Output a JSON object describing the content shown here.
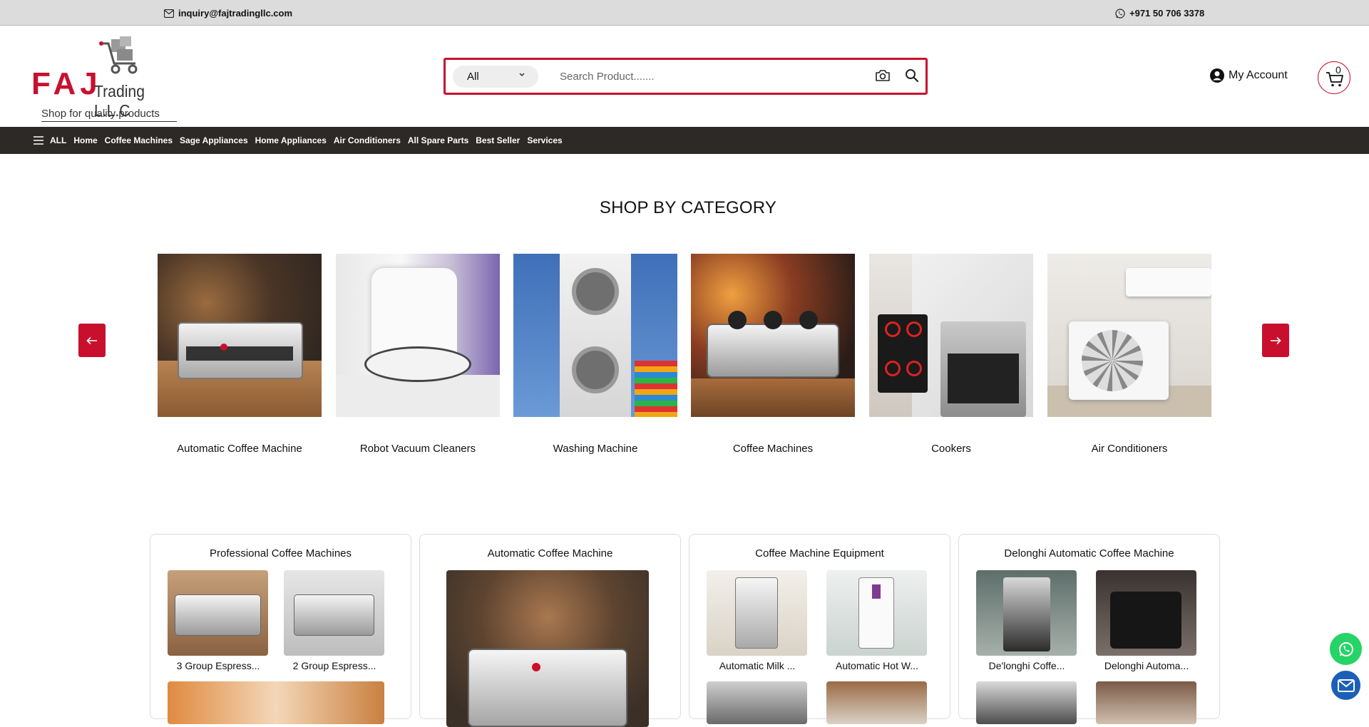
{
  "topbar": {
    "email": "inquiry@fajtradingllc.com",
    "phone": "+971 50 706 3378"
  },
  "logo": {
    "brand": "FAJ",
    "trading": "Trading L.L.C",
    "tagline": "Shop for quality products"
  },
  "search": {
    "category": "All",
    "placeholder": "Search Product......."
  },
  "account": {
    "label": "My Account"
  },
  "cart": {
    "count": "0"
  },
  "nav": {
    "all": "ALL",
    "items": [
      "Home",
      "Coffee Machines",
      "Sage Appliances",
      "Home Appliances",
      "Air Conditioners",
      "All Spare Parts",
      "Best Seller",
      "Services"
    ]
  },
  "section_title": "SHOP BY CATEGORY",
  "categories": [
    "Automatic Coffee Machine",
    "Robot Vacuum Cleaners",
    "Washing Machine",
    "Coffee Machines",
    "Cookers",
    "Air Conditioners"
  ],
  "panels": [
    {
      "title": "Professional Coffee Machines",
      "items": [
        "3 Group Espress...",
        "2 Group Espress..."
      ]
    },
    {
      "title": "Automatic Coffee Machine",
      "items": []
    },
    {
      "title": "Coffee Machine Equipment",
      "items": [
        "Automatic Milk ...",
        "Automatic Hot W..."
      ]
    },
    {
      "title": "Delonghi Automatic Coffee Machine",
      "items": [
        "De'longhi Coffe...",
        "Delonghi Automa..."
      ]
    }
  ],
  "colors": {
    "brand_red": "#c8102e",
    "nav_bg": "#2c2926",
    "topbar_bg": "#dcdcdc"
  },
  "icons": [
    "mail-icon",
    "whatsapp-icon",
    "camera-icon",
    "search-icon",
    "user-icon",
    "cart-icon",
    "menu-icon",
    "arrow-left-icon",
    "arrow-right-icon"
  ]
}
